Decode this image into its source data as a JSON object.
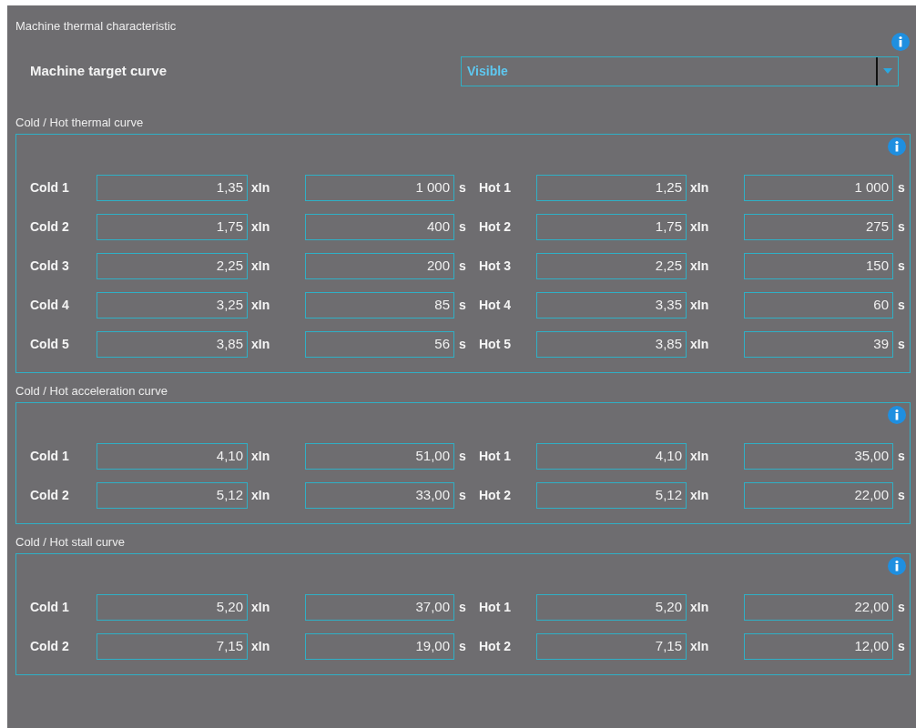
{
  "title": "Machine thermal characteristic",
  "target": {
    "label": "Machine target curve",
    "value": "Visible"
  },
  "sections": [
    {
      "title": "Cold / Hot thermal curve",
      "rows": [
        [
          {
            "label": "Cold 1",
            "factor": "1,35",
            "factor_unit": "xIn",
            "time": "1 000",
            "time_unit": "s"
          },
          {
            "label": "Hot 1",
            "factor": "1,25",
            "factor_unit": "xIn",
            "time": "1 000",
            "time_unit": "s"
          }
        ],
        [
          {
            "label": "Cold 2",
            "factor": "1,75",
            "factor_unit": "xIn",
            "time": "400",
            "time_unit": "s"
          },
          {
            "label": "Hot 2",
            "factor": "1,75",
            "factor_unit": "xIn",
            "time": "275",
            "time_unit": "s"
          }
        ],
        [
          {
            "label": "Cold 3",
            "factor": "2,25",
            "factor_unit": "xIn",
            "time": "200",
            "time_unit": "s"
          },
          {
            "label": "Hot 3",
            "factor": "2,25",
            "factor_unit": "xIn",
            "time": "150",
            "time_unit": "s"
          }
        ],
        [
          {
            "label": "Cold 4",
            "factor": "3,25",
            "factor_unit": "xIn",
            "time": "85",
            "time_unit": "s"
          },
          {
            "label": "Hot 4",
            "factor": "3,35",
            "factor_unit": "xIn",
            "time": "60",
            "time_unit": "s"
          }
        ],
        [
          {
            "label": "Cold 5",
            "factor": "3,85",
            "factor_unit": "xIn",
            "time": "56",
            "time_unit": "s"
          },
          {
            "label": "Hot 5",
            "factor": "3,85",
            "factor_unit": "xIn",
            "time": "39",
            "time_unit": "s"
          }
        ]
      ]
    },
    {
      "title": "Cold / Hot acceleration curve",
      "rows": [
        [
          {
            "label": "Cold 1",
            "factor": "4,10",
            "factor_unit": "xIn",
            "time": "51,00",
            "time_unit": "s"
          },
          {
            "label": "Hot 1",
            "factor": "4,10",
            "factor_unit": "xIn",
            "time": "35,00",
            "time_unit": "s"
          }
        ],
        [
          {
            "label": "Cold 2",
            "factor": "5,12",
            "factor_unit": "xIn",
            "time": "33,00",
            "time_unit": "s"
          },
          {
            "label": "Hot 2",
            "factor": "5,12",
            "factor_unit": "xIn",
            "time": "22,00",
            "time_unit": "s"
          }
        ]
      ]
    },
    {
      "title": "Cold / Hot stall curve",
      "rows": [
        [
          {
            "label": "Cold 1",
            "factor": "5,20",
            "factor_unit": "xIn",
            "time": "37,00",
            "time_unit": "s"
          },
          {
            "label": "Hot 1",
            "factor": "5,20",
            "factor_unit": "xIn",
            "time": "22,00",
            "time_unit": "s"
          }
        ],
        [
          {
            "label": "Cold 2",
            "factor": "7,15",
            "factor_unit": "xIn",
            "time": "19,00",
            "time_unit": "s"
          },
          {
            "label": "Hot 2",
            "factor": "7,15",
            "factor_unit": "xIn",
            "time": "12,00",
            "time_unit": "s"
          }
        ]
      ]
    }
  ]
}
